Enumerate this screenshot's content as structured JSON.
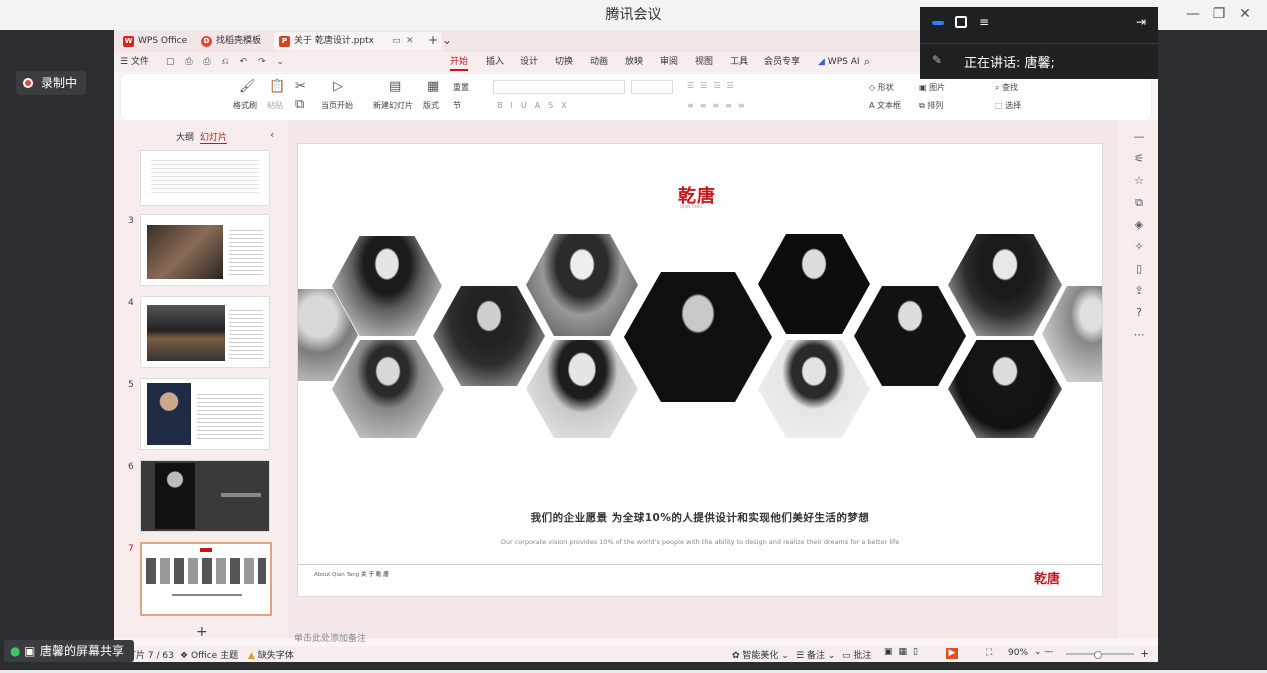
{
  "meeting": {
    "title": "腾讯会议",
    "recording_label": "录制中",
    "speaking_label": "正在讲话:",
    "speaker_name": "唐馨;",
    "share_label": "唐馨的屏幕共享"
  },
  "tabs": [
    {
      "label": "WPS Office",
      "icon": "wps-logo"
    },
    {
      "label": "找稻壳模板",
      "icon": "docer-logo"
    },
    {
      "label": "关于 乾唐设计.pptx",
      "icon": "ppt-file-icon"
    }
  ],
  "menu": {
    "file": "文件",
    "items": [
      "开始",
      "插入",
      "设计",
      "切换",
      "动画",
      "放映",
      "审阅",
      "视图",
      "工具",
      "会员专享"
    ],
    "wps_ai": "WPS AI"
  },
  "ribbon": {
    "format_painter": "格式刷",
    "paste": "粘贴",
    "play_current": "当页开始",
    "new_slide": "新建幻灯片",
    "layout": "版式",
    "section": "节",
    "reset": "重置",
    "shape": "形状",
    "picture": "图片",
    "textbox": "文本框",
    "arrange": "排列",
    "find": "查找",
    "select": "选择"
  },
  "panel": {
    "outline": "大纲",
    "slides": "幻灯片",
    "thumb_numbers": [
      "3",
      "4",
      "5",
      "6",
      "7"
    ],
    "add": "+"
  },
  "slide": {
    "logo": "乾唐",
    "logo_sub": "QIAN TANG",
    "vision_cn": "我们的企业愿景  为全球10%的人提供设计和实现他们美好生活的梦想",
    "vision_en": "Our corporate vision provides 10% of the world's people with the ability to design and realize their dreams for a better life",
    "footer_left_en": "About Qian Tang",
    "footer_left_cn": "关 于 乾 唐",
    "footer_logo": "乾唐"
  },
  "notes_placeholder": "单击此处添加备注",
  "status": {
    "slide_counter": "幻灯片 7 / 63",
    "theme": "Office 主题",
    "missing_font": "缺失字体",
    "beautify": "智能美化",
    "notes": "备注",
    "comments": "批注",
    "zoom": "90%"
  },
  "colors": {
    "brand_red": "#c8161d",
    "record_red": "#e7463d",
    "accent_blue": "#1f6feb"
  }
}
